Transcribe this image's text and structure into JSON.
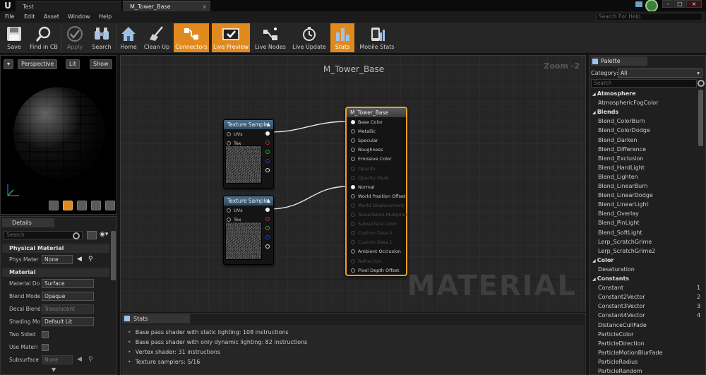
{
  "titlebar": {
    "project_tab": "Test",
    "material_tab": "M_Tower_Base",
    "close_glyph": "x"
  },
  "menubar": {
    "items": [
      "File",
      "Edit",
      "Asset",
      "Window",
      "Help"
    ],
    "help_search_placeholder": "Search For Help"
  },
  "toolbar": {
    "buttons": [
      {
        "label": "Save",
        "icon": "save-icon",
        "state": "normal"
      },
      {
        "label": "Find in CB",
        "icon": "find-in-cb-icon",
        "state": "normal"
      },
      {
        "label": "Apply",
        "icon": "apply-icon",
        "state": "disabled"
      },
      {
        "label": "Search",
        "icon": "search-icon",
        "state": "normal"
      },
      {
        "label": "Home",
        "icon": "home-icon",
        "state": "normal"
      },
      {
        "label": "Clean Up",
        "icon": "clean-up-icon",
        "state": "normal"
      },
      {
        "label": "Connectors",
        "icon": "connectors-icon",
        "state": "active"
      },
      {
        "label": "Live Preview",
        "icon": "live-preview-icon",
        "state": "active"
      },
      {
        "label": "Live Nodes",
        "icon": "live-nodes-icon",
        "state": "normal"
      },
      {
        "label": "Live Update",
        "icon": "live-update-icon",
        "state": "normal"
      },
      {
        "label": "Stats",
        "icon": "stats-icon",
        "state": "active"
      },
      {
        "label": "Mobile Stats",
        "icon": "mobile-stats-icon",
        "state": "normal"
      }
    ],
    "accent": "#e08a1e"
  },
  "viewport": {
    "perspective_label": "Perspective",
    "lit_label": "Lit",
    "show_label": "Show"
  },
  "details": {
    "tab_label": "Details",
    "search_placeholder": "Search",
    "categories": [
      "Physical Material",
      "Material"
    ],
    "phys_mat_label": "Phys Mater",
    "phys_mat_value": "None",
    "props": [
      {
        "label": "Material Do",
        "value": "Surface",
        "kind": "dropdown"
      },
      {
        "label": "Blend Mode",
        "value": "Opaque",
        "kind": "dropdown"
      },
      {
        "label": "Decal Blend",
        "value": "Translucent",
        "kind": "dropdown-disabled"
      },
      {
        "label": "Shading Mo",
        "value": "Default Lit",
        "kind": "dropdown"
      },
      {
        "label": "Two Sided",
        "value": "",
        "kind": "checkbox"
      },
      {
        "label": "Use Materi",
        "value": "",
        "kind": "checkbox"
      },
      {
        "label": "Subsurface",
        "value": "None",
        "kind": "dropdown-disabled"
      }
    ]
  },
  "graph": {
    "title": "M_Tower_Base",
    "zoom": "Zoom -2",
    "watermark": "MATERIAL",
    "texture_nodes": [
      {
        "title": "Texture Sample",
        "inputs": [
          "UVs",
          "Tex"
        ]
      },
      {
        "title": "Texture Sample",
        "inputs": [
          "UVs",
          "Tex"
        ]
      }
    ],
    "output_colors": [
      "#eeeeee",
      "#d02020",
      "#20c020",
      "#2040d0",
      "#dddddd"
    ],
    "main_node": {
      "title": "M_Tower_Base",
      "pins": [
        {
          "label": "Base Color",
          "enabled": true,
          "connected": true
        },
        {
          "label": "Metallic",
          "enabled": true,
          "connected": false
        },
        {
          "label": "Specular",
          "enabled": true,
          "connected": false
        },
        {
          "label": "Roughness",
          "enabled": true,
          "connected": false
        },
        {
          "label": "Emissive Color",
          "enabled": true,
          "connected": false
        },
        {
          "label": "Opacity",
          "enabled": false,
          "connected": false
        },
        {
          "label": "Opacity Mask",
          "enabled": false,
          "connected": false
        },
        {
          "label": "Normal",
          "enabled": true,
          "connected": true
        },
        {
          "label": "World Position Offset",
          "enabled": true,
          "connected": false
        },
        {
          "label": "World Displacement",
          "enabled": false,
          "connected": false
        },
        {
          "label": "Tessellation Multiplier",
          "enabled": false,
          "connected": false
        },
        {
          "label": "Subsurface Color",
          "enabled": false,
          "connected": false
        },
        {
          "label": "Custom Data 0",
          "enabled": false,
          "connected": false
        },
        {
          "label": "Custom Data 1",
          "enabled": false,
          "connected": false
        },
        {
          "label": "Ambient Occlusion",
          "enabled": true,
          "connected": false
        },
        {
          "label": "Refraction",
          "enabled": false,
          "connected": false
        },
        {
          "label": "Pixel Depth Offset",
          "enabled": true,
          "connected": false
        }
      ]
    }
  },
  "stats": {
    "tab_label": "Stats",
    "lines": [
      "Base pass shader with static lighting: 108 instructions",
      "Base pass shader with only dynamic lighting: 82 instructions",
      "Vertex shader: 31 instructions",
      "Texture samplers: 5/16"
    ]
  },
  "palette": {
    "tab_label": "Palette",
    "category_label": "Category:",
    "category_value": "All",
    "search_placeholder": "Search",
    "items": [
      {
        "text": "Atmosphere",
        "type": "category"
      },
      {
        "text": "AtmosphericFogColor",
        "type": "item"
      },
      {
        "text": "Blends",
        "type": "category"
      },
      {
        "text": "Blend_ColorBurn",
        "type": "item"
      },
      {
        "text": "Blend_ColorDodge",
        "type": "item"
      },
      {
        "text": "Blend_Darken",
        "type": "item"
      },
      {
        "text": "Blend_Difference",
        "type": "item"
      },
      {
        "text": "Blend_Exclusion",
        "type": "item"
      },
      {
        "text": "Blend_HardLight",
        "type": "item"
      },
      {
        "text": "Blend_Lighten",
        "type": "item"
      },
      {
        "text": "Blend_LinearBurn",
        "type": "item"
      },
      {
        "text": "Blend_LinearDodge",
        "type": "item"
      },
      {
        "text": "Blend_LinearLight",
        "type": "item"
      },
      {
        "text": "Blend_Overlay",
        "type": "item"
      },
      {
        "text": "Blend_PinLight",
        "type": "item"
      },
      {
        "text": "Blend_SoftLight",
        "type": "item"
      },
      {
        "text": "Lerp_ScratchGrime",
        "type": "item"
      },
      {
        "text": "Lerp_ScratchGrime2",
        "type": "item"
      },
      {
        "text": "Color",
        "type": "category"
      },
      {
        "text": "Desaturation",
        "type": "item"
      },
      {
        "text": "Constants",
        "type": "category"
      },
      {
        "text": "Constant",
        "type": "item",
        "key": "1"
      },
      {
        "text": "Constant2Vector",
        "type": "item",
        "key": "2"
      },
      {
        "text": "Constant3Vector",
        "type": "item",
        "key": "3"
      },
      {
        "text": "Constant4Vector",
        "type": "item",
        "key": "4"
      },
      {
        "text": "DistanceCullFade",
        "type": "item"
      },
      {
        "text": "ParticleColor",
        "type": "item"
      },
      {
        "text": "ParticleDirection",
        "type": "item"
      },
      {
        "text": "ParticleMotionBlurFade",
        "type": "item"
      },
      {
        "text": "ParticleRadius",
        "type": "item"
      },
      {
        "text": "ParticleRandom",
        "type": "item"
      }
    ]
  }
}
